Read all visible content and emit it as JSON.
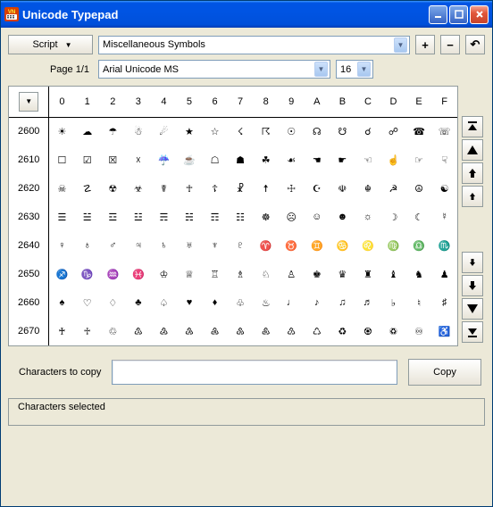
{
  "window": {
    "title": "Unicode Typepad"
  },
  "toolbar": {
    "script_label": "Script",
    "category": "Miscellaneous Symbols",
    "plus": "+",
    "minus": "−",
    "undo": "↶"
  },
  "font_row": {
    "page_label": "Page 1/1",
    "font_name": "Arial Unicode MS",
    "font_size": "16"
  },
  "grid": {
    "col_headers": [
      "0",
      "1",
      "2",
      "3",
      "4",
      "5",
      "6",
      "7",
      "8",
      "9",
      "A",
      "B",
      "C",
      "D",
      "E",
      "F"
    ],
    "rows": [
      {
        "code": "2600",
        "cells": [
          "☀",
          "☁",
          "☂",
          "☃",
          "☄",
          "★",
          "☆",
          "☇",
          "☈",
          "☉",
          "☊",
          "☋",
          "☌",
          "☍",
          "☎",
          "☏"
        ]
      },
      {
        "code": "2610",
        "cells": [
          "☐",
          "☑",
          "☒",
          "☓",
          "☔",
          "☕",
          "☖",
          "☗",
          "☘",
          "☙",
          "☚",
          "☛",
          "☜",
          "☝",
          "☞",
          "☟"
        ]
      },
      {
        "code": "2620",
        "cells": [
          "☠",
          "☡",
          "☢",
          "☣",
          "☤",
          "☥",
          "☦",
          "☧",
          "☨",
          "☩",
          "☪",
          "☫",
          "☬",
          "☭",
          "☮",
          "☯"
        ]
      },
      {
        "code": "2630",
        "cells": [
          "☰",
          "☱",
          "☲",
          "☳",
          "☴",
          "☵",
          "☶",
          "☷",
          "☸",
          "☹",
          "☺",
          "☻",
          "☼",
          "☽",
          "☾",
          "☿"
        ]
      },
      {
        "code": "2640",
        "cells": [
          "♀",
          "♁",
          "♂",
          "♃",
          "♄",
          "♅",
          "♆",
          "♇",
          "♈",
          "♉",
          "♊",
          "♋",
          "♌",
          "♍",
          "♎",
          "♏"
        ]
      },
      {
        "code": "2650",
        "cells": [
          "♐",
          "♑",
          "♒",
          "♓",
          "♔",
          "♕",
          "♖",
          "♗",
          "♘",
          "♙",
          "♚",
          "♛",
          "♜",
          "♝",
          "♞",
          "♟"
        ]
      },
      {
        "code": "2660",
        "cells": [
          "♠",
          "♡",
          "♢",
          "♣",
          "♤",
          "♥",
          "♦",
          "♧",
          "♨",
          "♩",
          "♪",
          "♫",
          "♬",
          "♭",
          "♮",
          "♯"
        ]
      },
      {
        "code": "2670",
        "cells": [
          "♰",
          "♱",
          "♲",
          "♳",
          "♴",
          "♵",
          "♶",
          "♷",
          "♸",
          "♹",
          "♺",
          "♻",
          "♼",
          "♽",
          "♾",
          "♿"
        ]
      }
    ]
  },
  "nav": {
    "top": "⤒",
    "page_up": "▲",
    "up": "↑",
    "up_small": "↑",
    "down_small": "↓",
    "down": "↓",
    "page_down": "▼",
    "bottom": "⤓"
  },
  "copy": {
    "label": "Characters to copy",
    "value": "",
    "button": "Copy"
  },
  "status": {
    "text": "Characters selected"
  }
}
